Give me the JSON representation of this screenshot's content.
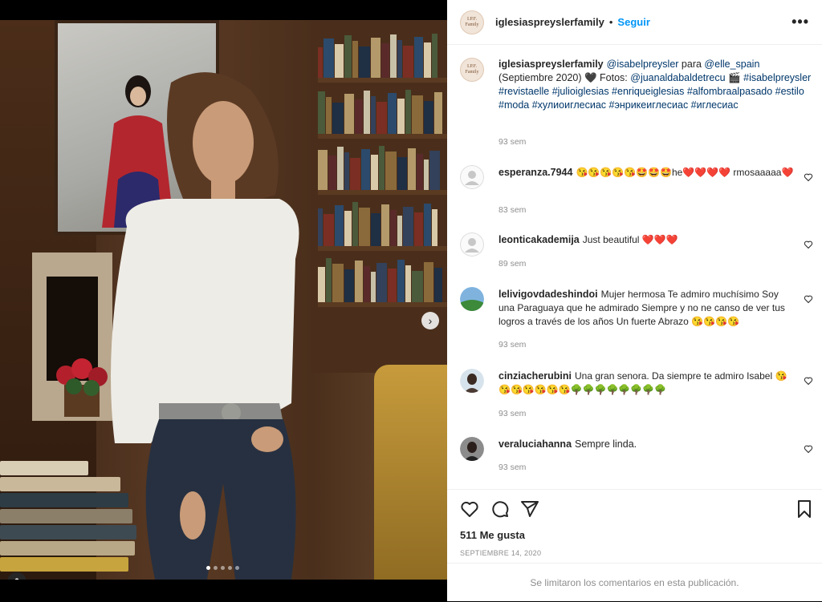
{
  "post": {
    "author": "iglesiaspreyslerfamily",
    "avatar_lines": [
      "I.P.F.",
      "Family"
    ],
    "follow_label": "Seguir",
    "separator": "•",
    "more_label": "•••",
    "caption_mentions": [
      "@isabelpreysler",
      "@elle_spain",
      "@juanaldabaldetrecu"
    ],
    "caption_parts": {
      "m1": "@isabelpreysler",
      "t1": " para ",
      "m2": "@elle_spain",
      "t2": " (Septiembre 2020) 🖤 Fotos: ",
      "m3": "@juanaldabaldetrecu",
      "t3": " 🎬",
      "tags": "#isabelpreysler #revistaelle #julioiglesias #enriqueiglesias #alfombraalpasado #estilo #moda #хулиоиглесиас #энрикеиглесиас #иглесиас"
    },
    "caption_time": "93 sem",
    "likes": "511 Me gusta",
    "date": "SEPTIEMBRE 14, 2020",
    "comments_disabled": "Se limitaron los comentarios en esta publicación.",
    "carousel": {
      "slides": 5,
      "active": 1
    }
  },
  "comments": [
    {
      "user": "esperanza.7944",
      "text": "😘😘😘😘😘🤩🤩🤩he❤️❤️❤️❤️ rmosaaaaa❤️",
      "time": "83 sem",
      "avatar": "default"
    },
    {
      "user": "leonticakademija",
      "text": "Just beautiful ❤️❤️❤️",
      "time": "89 sem",
      "avatar": "default"
    },
    {
      "user": "lelivigovdadeshindoi",
      "text": "Mujer hermosa Te admiro muchísimo Soy una Paraguaya que he admirado Siempre y no ne canso de ver tus logros a través de los años Un fuerte Abrazo 😘😘😘😘",
      "time": "93 sem",
      "avatar": "landscape"
    },
    {
      "user": "cinziacherubini",
      "text": "Una gran senora. Da siempre te admiro Isabel 😘😘😘😘😘😘😘🌳🌳🌳🌳🌳🌳🌳🌳",
      "time": "93 sem",
      "avatar": "portrait"
    },
    {
      "user": "veraluciahanna",
      "text": "Sempre linda.",
      "time": "93 sem",
      "avatar": "portrait-dark"
    }
  ],
  "icons": {
    "like": "heart-icon",
    "comment": "comment-icon",
    "share": "share-icon",
    "save": "bookmark-icon",
    "next": "chevron-right-icon",
    "tag": "user-tag-icon"
  },
  "colors": {
    "link": "#00376b",
    "follow": "#0095f6",
    "meta": "#8e8e8e"
  }
}
